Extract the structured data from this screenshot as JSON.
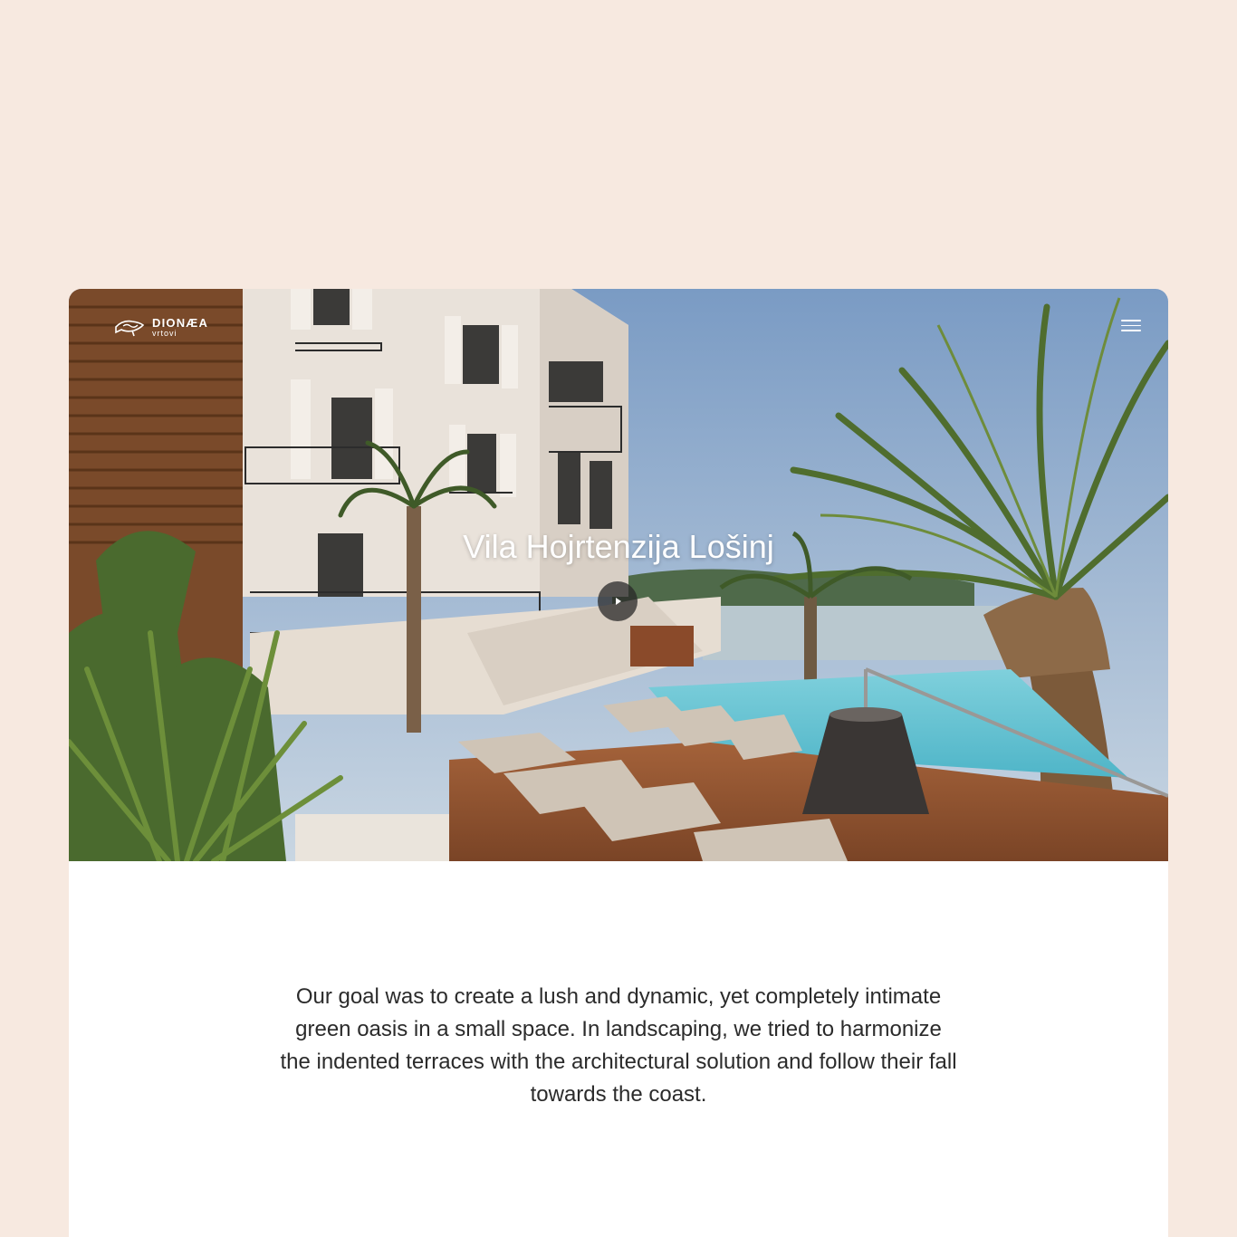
{
  "brand": {
    "name": "DIONÆA",
    "subtitle": "vrtovi",
    "logo_icon": "fish-logo-icon"
  },
  "header": {
    "menu_icon": "hamburger-menu-icon"
  },
  "hero": {
    "title": "Vila Hojrtenzija Lošinj",
    "play_icon": "play-icon"
  },
  "content": {
    "description": "Our goal was to create a lush and dynamic, yet completely intimate green oasis in a small space. In landscaping, we tried to harmonize the indented terraces with the architectural solution and follow their fall towards the coast."
  },
  "colors": {
    "page_background": "#f7e9e0",
    "card_background": "#ffffff",
    "text": "#2b2b2b"
  }
}
